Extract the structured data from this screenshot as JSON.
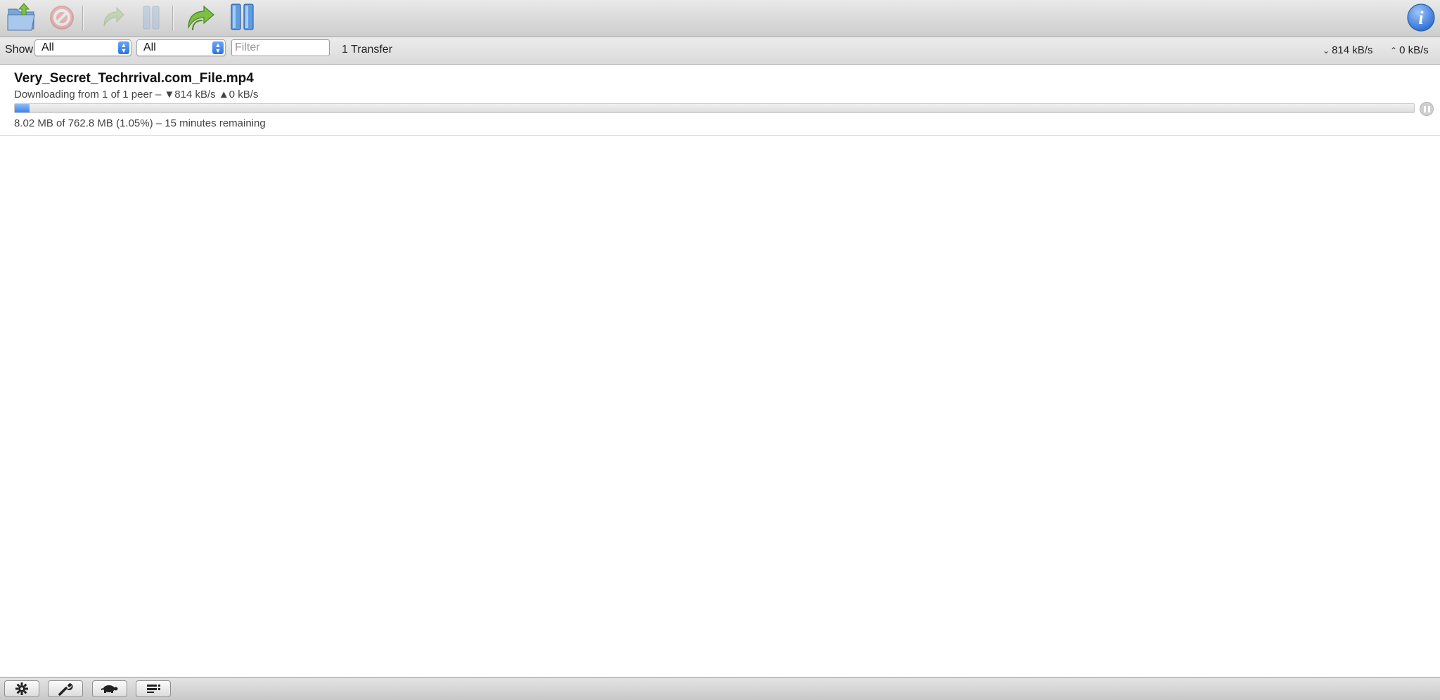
{
  "toolbar": {
    "buttons": [
      {
        "name": "open-torrent",
        "icon": "folder-open-icon",
        "enabled": true
      },
      {
        "name": "remove",
        "icon": "remove-icon",
        "enabled": false
      },
      {
        "name": "resume-selected",
        "icon": "resume-arrow-icon",
        "enabled": false
      },
      {
        "name": "pause-selected",
        "icon": "pause-icon",
        "enabled": false
      },
      {
        "name": "resume-all",
        "icon": "resume-all-arrow-icon",
        "enabled": true
      },
      {
        "name": "pause-all",
        "icon": "pause-all-icon",
        "enabled": true
      },
      {
        "name": "inspector",
        "icon": "info-icon",
        "enabled": true
      }
    ]
  },
  "filterbar": {
    "show_label": "Show",
    "status_filter": {
      "selected": "All"
    },
    "group_filter": {
      "selected": "All"
    },
    "search_placeholder": "Filter",
    "transfer_count": "1 Transfer",
    "download_speed": "814 kB/s",
    "upload_speed": "0 kB/s"
  },
  "transfers": [
    {
      "name": "Very_Secret_Techrrival.com_File.mp4",
      "status": "Downloading from 1 of 1 peer – ▼814 kB/s ▲0 kB/s",
      "progress_percent": 1.05,
      "detail": "8.02 MB of 762.8 MB (1.05%) – 15 minutes remaining"
    }
  ],
  "bottombar": {
    "buttons": [
      {
        "name": "action-menu",
        "icon": "gear-icon"
      },
      {
        "name": "preferences",
        "icon": "wrench-icon"
      },
      {
        "name": "speed-limit",
        "icon": "turtle-icon"
      },
      {
        "name": "filter-bar-toggle",
        "icon": "filter-bar-icon"
      }
    ]
  },
  "colors": {
    "progress": "#3b82e6",
    "select_arrows": "#2f73e0",
    "info": "#2f6fd6",
    "resume_green": "#6db33f"
  }
}
